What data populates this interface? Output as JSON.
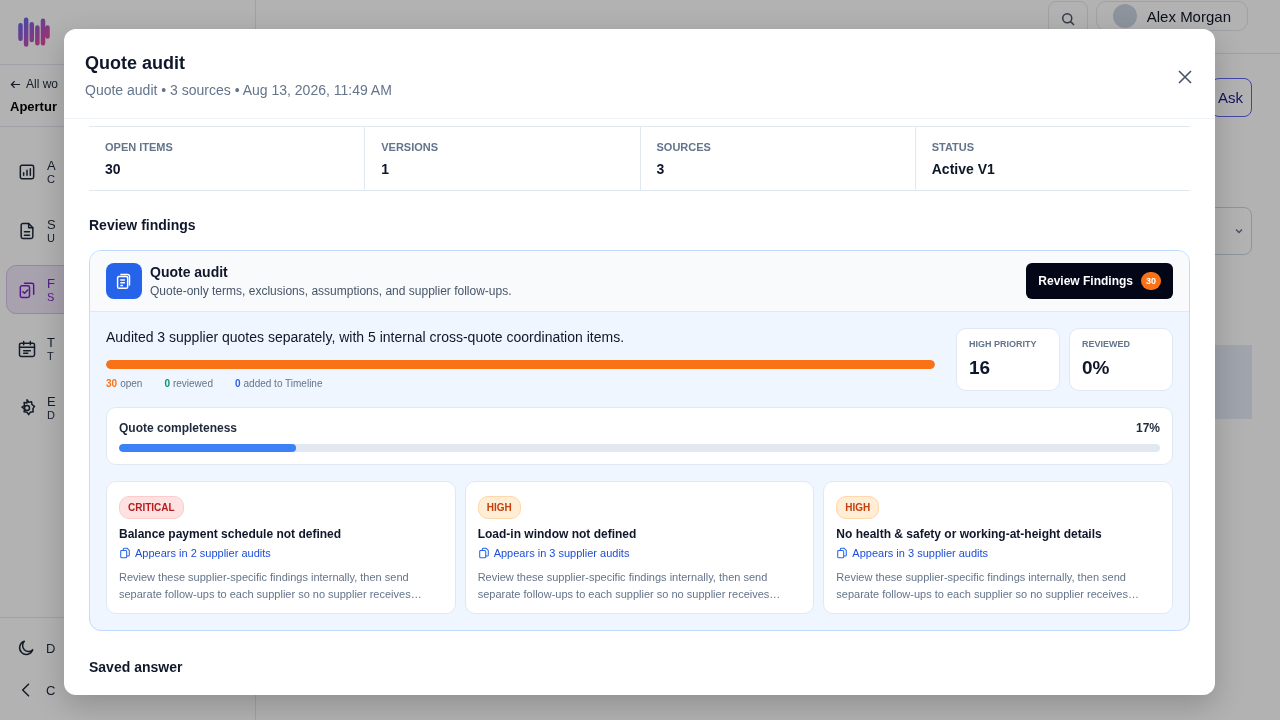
{
  "background": {
    "back_link": "All wo",
    "workspace": "Apertur",
    "user": {
      "name": "Alex Morgan"
    },
    "ask_button": "Ask",
    "nav": [
      {
        "label": "A",
        "sub": "C",
        "selected": false
      },
      {
        "label": "S",
        "sub": "U",
        "selected": false
      },
      {
        "label": "F",
        "sub": "S",
        "selected": true
      },
      {
        "label": "T",
        "sub": "T",
        "selected": false
      },
      {
        "label": "E",
        "sub": "D",
        "selected": false
      }
    ],
    "footer": [
      {
        "label": "D"
      },
      {
        "label": "C"
      }
    ]
  },
  "modal": {
    "title": "Quote audit",
    "subtitle": "Quote audit • 3 sources • Aug 13, 2026, 11:49 AM",
    "stats": [
      {
        "label": "OPEN ITEMS",
        "value": "30"
      },
      {
        "label": "VERSIONS",
        "value": "1"
      },
      {
        "label": "SOURCES",
        "value": "3"
      },
      {
        "label": "STATUS",
        "value": "Active V1"
      }
    ],
    "section_title": "Review findings",
    "card": {
      "title": "Quote audit",
      "description": "Quote-only terms, exclusions, assumptions, and supplier follow-ups.",
      "button": {
        "label": "Review Findings",
        "count": "30"
      },
      "summary": "Audited 3 supplier quotes separately, with 5 internal cross-quote coordination items.",
      "open_bar": {
        "level": 1.0
      },
      "counts": [
        {
          "value": "30",
          "label": "open",
          "color": "#f97316"
        },
        {
          "value": "0",
          "label": "reviewed",
          "color": "#059669"
        },
        {
          "value": "0",
          "label": "added to Timeline",
          "color": "#2563eb"
        }
      ],
      "metrics": [
        {
          "label": "HIGH PRIORITY",
          "value": "16"
        },
        {
          "label": "REVIEWED",
          "value": "0%"
        }
      ],
      "completeness": {
        "label": "Quote completeness",
        "reading": "17%",
        "level": 0.17
      },
      "findings": [
        {
          "kind": "critical",
          "severity": "CRITICAL",
          "title": "Balance payment schedule not defined",
          "link": "Appears in 2 supplier audits",
          "text": "Review these supplier-specific findings internally, then send separate follow-ups to each supplier so no supplier receives…"
        },
        {
          "kind": "high",
          "severity": "HIGH",
          "title": "Load-in window not defined",
          "link": "Appears in 3 supplier audits",
          "text": "Review these supplier-specific findings internally, then send separate follow-ups to each supplier so no supplier receives…"
        },
        {
          "kind": "high",
          "severity": "HIGH",
          "title": "No health & safety or working-at-height details",
          "link": "Appears in 3 supplier audits",
          "text": "Review these supplier-specific findings internally, then send separate follow-ups to each supplier so no supplier receives…"
        }
      ]
    },
    "next_section": "Saved answer"
  }
}
